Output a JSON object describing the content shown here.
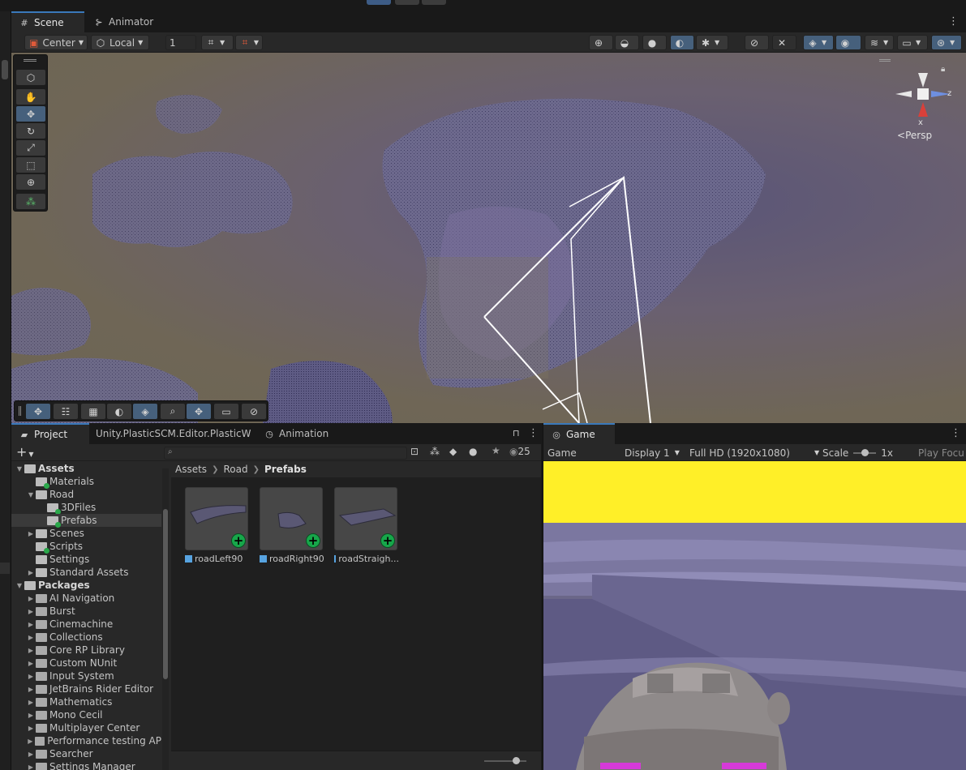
{
  "scene_panel": {
    "tabs": [
      {
        "label": "Scene",
        "icon": "grid-icon"
      },
      {
        "label": "Animator",
        "icon": "animator-icon"
      }
    ],
    "toolbar": {
      "pivot_mode": "Center",
      "pivot_rotation": "Local",
      "grid_value": "1"
    },
    "gizmo": {
      "projection": "Persp",
      "axis_x": "x",
      "axis_z": "z"
    }
  },
  "project_panel": {
    "tabs": [
      {
        "label": "Project",
        "icon": "folder-icon"
      },
      {
        "label": "Unity.PlasticSCM.Editor.PlasticW"
      },
      {
        "label": "Animation",
        "icon": "clock-icon"
      }
    ],
    "add_label": "+",
    "visible_count": "25",
    "tree": [
      {
        "label": "Assets",
        "depth": 0,
        "expanded": true,
        "bold": true
      },
      {
        "label": "Materials",
        "depth": 1,
        "badge": true
      },
      {
        "label": "Road",
        "depth": 1,
        "expanded": true
      },
      {
        "label": "3DFiles",
        "depth": 2,
        "badge": true
      },
      {
        "label": "Prefabs",
        "depth": 2,
        "badge": true,
        "selected": true
      },
      {
        "label": "Scenes",
        "depth": 1,
        "collapsed": true
      },
      {
        "label": "Scripts",
        "depth": 1,
        "badge": true
      },
      {
        "label": "Settings",
        "depth": 1
      },
      {
        "label": "Standard Assets",
        "depth": 1,
        "collapsed": true
      },
      {
        "label": "Packages",
        "depth": 0,
        "expanded": true,
        "bold": true
      },
      {
        "label": "AI Navigation",
        "depth": 1,
        "collapsed": true,
        "pkg": true
      },
      {
        "label": "Burst",
        "depth": 1,
        "collapsed": true,
        "pkg": true
      },
      {
        "label": "Cinemachine",
        "depth": 1,
        "collapsed": true,
        "pkg": true
      },
      {
        "label": "Collections",
        "depth": 1,
        "collapsed": true,
        "pkg": true
      },
      {
        "label": "Core RP Library",
        "depth": 1,
        "collapsed": true,
        "pkg": true
      },
      {
        "label": "Custom NUnit",
        "depth": 1,
        "collapsed": true,
        "pkg": true
      },
      {
        "label": "Input System",
        "depth": 1,
        "collapsed": true,
        "pkg": true
      },
      {
        "label": "JetBrains Rider Editor",
        "depth": 1,
        "collapsed": true,
        "pkg": true
      },
      {
        "label": "Mathematics",
        "depth": 1,
        "collapsed": true,
        "pkg": true
      },
      {
        "label": "Mono Cecil",
        "depth": 1,
        "collapsed": true,
        "pkg": true
      },
      {
        "label": "Multiplayer Center",
        "depth": 1,
        "collapsed": true,
        "pkg": true
      },
      {
        "label": "Performance testing AP",
        "depth": 1,
        "collapsed": true,
        "pkg": true
      },
      {
        "label": "Searcher",
        "depth": 1,
        "collapsed": true,
        "pkg": true
      },
      {
        "label": "Settings Manager",
        "depth": 1,
        "collapsed": true,
        "pkg": true
      }
    ],
    "breadcrumb": [
      "Assets",
      "Road",
      "Prefabs"
    ],
    "assets": [
      {
        "name": "roadLeft90"
      },
      {
        "name": "roadRight90"
      },
      {
        "name": "roadStraigh..."
      }
    ]
  },
  "game_panel": {
    "tab_label": "Game",
    "view_mode": "Game",
    "display": "Display 1",
    "resolution": "Full HD (1920x1080)",
    "scale_label": "Scale",
    "scale_value": "1x",
    "play_focus": "Play Focu"
  },
  "colors": {
    "accent": "#3a79bb",
    "selected_tool": "#46607c",
    "sky_yellow": "#ffef28",
    "add_badge": "#17a64a"
  }
}
